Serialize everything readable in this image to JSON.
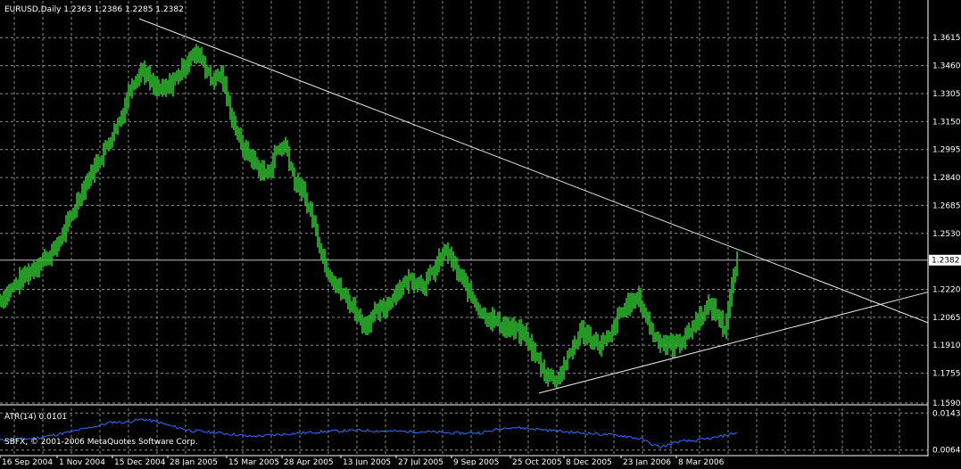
{
  "window": {
    "header": "EURUSD,Daily  1.2363 1.2386 1.2285 1.2382"
  },
  "colors": {
    "background": "#000000",
    "candles": "#2fbf2f",
    "grid": "#8a8a8a",
    "trendlines": "#e6e6e6",
    "atr": "#2f6fff",
    "text": "#ffffff"
  },
  "chart_data": [
    {
      "type": "bar",
      "symbol": "EURUSD",
      "timeframe": "Daily",
      "ohlc_last": {
        "open": 1.2363,
        "high": 1.2386,
        "low": 1.2285,
        "close": 1.2382
      },
      "ylim": [
        1.159,
        1.372
      ],
      "y_ticks": [
        1.3615,
        1.346,
        1.3305,
        1.315,
        1.2995,
        1.284,
        1.2685,
        1.253,
        1.222,
        1.2065,
        1.191,
        1.1755,
        1.159
      ],
      "y_tick_labels": [
        "1.3615",
        "1.3460",
        "1.3305",
        "1.3150",
        "1.2995",
        "1.2840",
        "1.2685",
        "1.2530",
        "1.2220",
        "1.2065",
        "1.1910",
        "1.1755",
        "1.1590"
      ],
      "current_price_label": "1.2382",
      "current_price": 1.2382,
      "x_tick_labels": [
        "16 Sep 2004",
        "1 Nov 2004",
        "15 Dec 2004",
        "28 Jan 2005",
        "15 Mar 2005",
        "28 Apr 2005",
        "13 Jun 2005",
        "27 Jul 2005",
        "9 Sep 2005",
        "25 Oct 2005",
        "8 Dec 2005",
        "23 Jan 2006",
        "8 Mar 2006"
      ],
      "x_tick_bar_index": [
        0,
        32,
        63,
        94,
        127,
        158,
        191,
        222,
        253,
        286,
        316,
        348,
        379
      ],
      "bars_total": 413,
      "x_extent_bars": 520,
      "closes_anchor": [
        [
          0,
          1.216
        ],
        [
          10,
          1.226
        ],
        [
          20,
          1.235
        ],
        [
          30,
          1.243
        ],
        [
          38,
          1.258
        ],
        [
          45,
          1.275
        ],
        [
          52,
          1.288
        ],
        [
          60,
          1.302
        ],
        [
          68,
          1.318
        ],
        [
          74,
          1.337
        ],
        [
          80,
          1.344
        ],
        [
          86,
          1.334
        ],
        [
          92,
          1.332
        ],
        [
          100,
          1.341
        ],
        [
          106,
          1.35
        ],
        [
          112,
          1.353
        ],
        [
          118,
          1.338
        ],
        [
          124,
          1.341
        ],
        [
          129,
          1.321
        ],
        [
          135,
          1.302
        ],
        [
          140,
          1.296
        ],
        [
          146,
          1.288
        ],
        [
          150,
          1.286
        ],
        [
          155,
          1.299
        ],
        [
          160,
          1.302
        ],
        [
          165,
          1.282
        ],
        [
          170,
          1.275
        ],
        [
          175,
          1.262
        ],
        [
          182,
          1.236
        ],
        [
          190,
          1.222
        ],
        [
          198,
          1.212
        ],
        [
          204,
          1.202
        ],
        [
          210,
          1.208
        ],
        [
          216,
          1.212
        ],
        [
          222,
          1.221
        ],
        [
          230,
          1.228
        ],
        [
          238,
          1.225
        ],
        [
          244,
          1.234
        ],
        [
          250,
          1.244
        ],
        [
          256,
          1.232
        ],
        [
          262,
          1.222
        ],
        [
          270,
          1.209
        ],
        [
          280,
          1.203
        ],
        [
          286,
          1.2
        ],
        [
          294,
          1.197
        ],
        [
          300,
          1.185
        ],
        [
          306,
          1.175
        ],
        [
          312,
          1.172
        ],
        [
          318,
          1.183
        ],
        [
          322,
          1.192
        ],
        [
          326,
          1.199
        ],
        [
          330,
          1.196
        ],
        [
          336,
          1.191
        ],
        [
          342,
          1.195
        ],
        [
          346,
          1.206
        ],
        [
          352,
          1.214
        ],
        [
          358,
          1.217
        ],
        [
          362,
          1.207
        ],
        [
          366,
          1.197
        ],
        [
          372,
          1.192
        ],
        [
          378,
          1.191
        ],
        [
          384,
          1.196
        ],
        [
          388,
          1.201
        ],
        [
          392,
          1.207
        ],
        [
          398,
          1.213
        ],
        [
          402,
          1.208
        ],
        [
          406,
          1.2
        ],
        [
          410,
          1.222
        ],
        [
          413,
          1.2382
        ]
      ],
      "trendlines": [
        {
          "from": [
            78,
            1.372
          ],
          "to": [
            520,
            1.2035
          ]
        },
        {
          "from": [
            302,
            1.1645
          ],
          "to": [
            520,
            1.2205
          ]
        }
      ]
    },
    {
      "type": "line",
      "indicator": "ATR(14)",
      "label": "ATR(14) 0.0101",
      "value": 0.0101,
      "ylim": [
        0.0054,
        0.0153
      ],
      "y_tick_labels": [
        "0.0143",
        "0.0064"
      ],
      "y_ticks": [
        0.0143,
        0.0064
      ],
      "x_extent_bars": 520,
      "anchors": [
        [
          0,
          0.0085
        ],
        [
          20,
          0.0089
        ],
        [
          40,
          0.0103
        ],
        [
          55,
          0.0116
        ],
        [
          63,
          0.0124
        ],
        [
          70,
          0.0123
        ],
        [
          80,
          0.013
        ],
        [
          88,
          0.0124
        ],
        [
          96,
          0.0115
        ],
        [
          108,
          0.0105
        ],
        [
          125,
          0.01
        ],
        [
          140,
          0.0093
        ],
        [
          160,
          0.0098
        ],
        [
          180,
          0.0103
        ],
        [
          200,
          0.0106
        ],
        [
          220,
          0.0104
        ],
        [
          240,
          0.0103
        ],
        [
          255,
          0.01
        ],
        [
          270,
          0.0101
        ],
        [
          285,
          0.0113
        ],
        [
          300,
          0.0109
        ],
        [
          320,
          0.0102
        ],
        [
          340,
          0.0097
        ],
        [
          350,
          0.0094
        ],
        [
          360,
          0.0087
        ],
        [
          365,
          0.0077
        ],
        [
          370,
          0.007
        ],
        [
          380,
          0.0082
        ],
        [
          390,
          0.0084
        ],
        [
          400,
          0.009
        ],
        [
          413,
          0.0101
        ]
      ]
    }
  ],
  "footer": {
    "copyright": "SBFX, © 2001-2006 MetaQuotes Software Corp."
  }
}
